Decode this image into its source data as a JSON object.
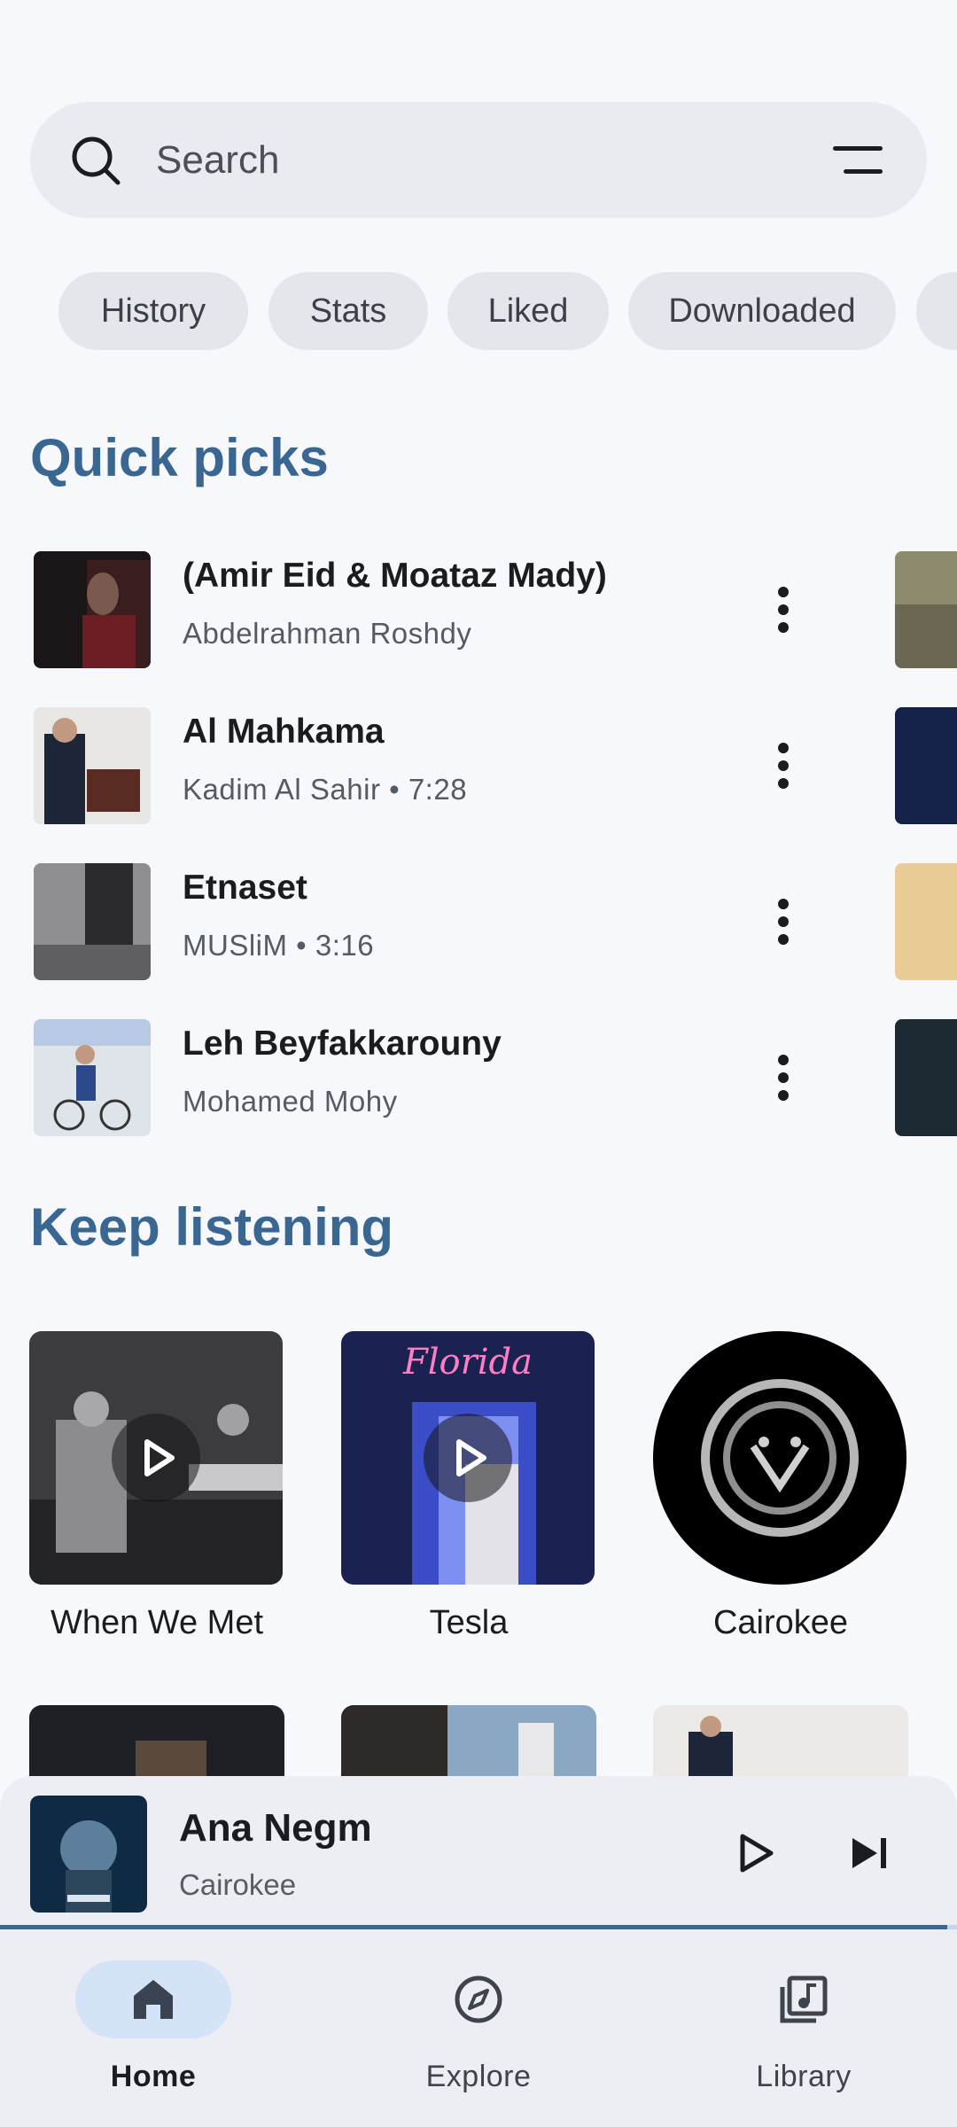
{
  "search": {
    "placeholder": "Search"
  },
  "chips": [
    "History",
    "Stats",
    "Liked",
    "Downloaded"
  ],
  "quick_picks": {
    "title": "Quick picks",
    "items": [
      {
        "title": "(Amir Eid & Moataz Mady)",
        "subtitle": "Abdelrahman Roshdy"
      },
      {
        "title": "Al Mahkama",
        "subtitle": "Kadim Al Sahir • 7:28"
      },
      {
        "title": "Etnaset",
        "subtitle": "MUSliM • 3:16"
      },
      {
        "title": "Leh Beyfakkarouny",
        "subtitle": "Mohamed Mohy"
      }
    ]
  },
  "keep_listening": {
    "title": "Keep listening",
    "items": [
      {
        "label": "When We Met"
      },
      {
        "label": "Tesla"
      },
      {
        "label": "Cairokee"
      }
    ]
  },
  "mini_player": {
    "title": "Ana Negm",
    "artist": "Cairokee",
    "progress": 0.99
  },
  "nav": {
    "items": [
      {
        "label": "Home",
        "icon": "home-icon",
        "active": true
      },
      {
        "label": "Explore",
        "icon": "compass-icon",
        "active": false
      },
      {
        "label": "Library",
        "icon": "library-music-icon",
        "active": false
      }
    ]
  },
  "colors": {
    "accent": "#3a6792",
    "background": "#f7f8fc",
    "surface": "#eceef3",
    "nav_active_pill": "#d4e3f8"
  }
}
